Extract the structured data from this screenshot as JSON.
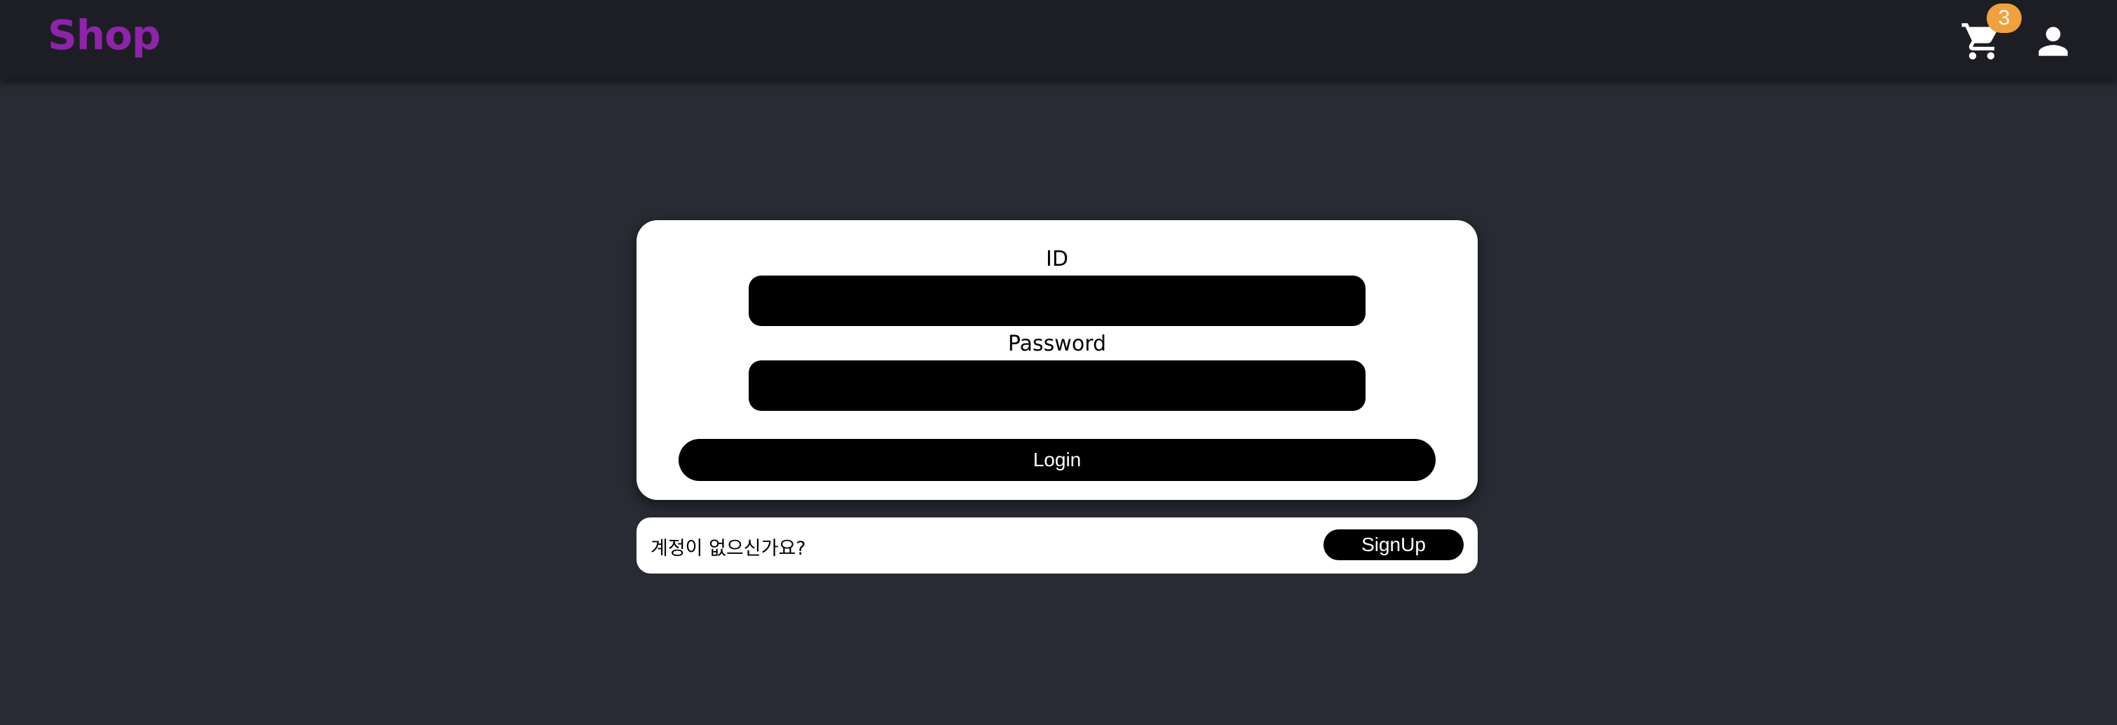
{
  "header": {
    "brand": "Shop",
    "cart": {
      "icon": "shopping-cart-icon",
      "badge_count": "3"
    },
    "account": {
      "icon": "person-icon"
    }
  },
  "login": {
    "id_label": "ID",
    "id_value": "",
    "password_label": "Password",
    "password_value": "",
    "login_button": "Login"
  },
  "signup": {
    "prompt": "계정이 없으신가요?",
    "button": "SignUp"
  },
  "colors": {
    "page_background": "#282b33",
    "header_background": "#1d1e23",
    "brand": "#8e24aa",
    "badge": "#f0a13c",
    "card": "#ffffff",
    "input_and_button": "#000000"
  }
}
